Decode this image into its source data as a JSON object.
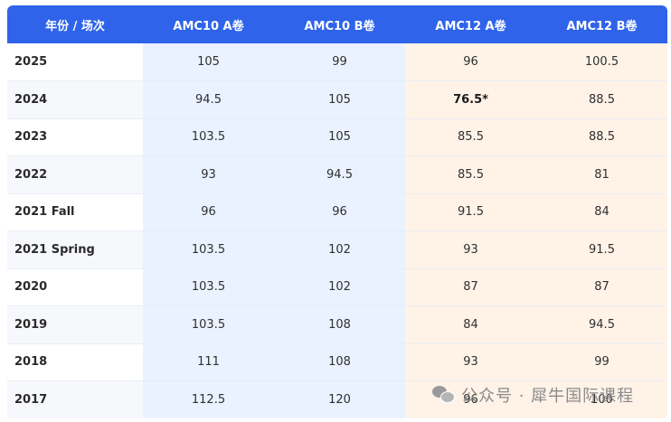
{
  "table": {
    "headers": [
      "年份 / 场次",
      "AMC10 A卷",
      "AMC10 B卷",
      "AMC12 A卷",
      "AMC12 B卷"
    ],
    "rows": [
      {
        "year": "2025",
        "amc10a": "105",
        "amc10b": "99",
        "amc12a": "96",
        "amc12b": "100.5"
      },
      {
        "year": "2024",
        "amc10a": "94.5",
        "amc10b": "105",
        "amc12a": "76.5*",
        "amc12b": "88.5"
      },
      {
        "year": "2023",
        "amc10a": "103.5",
        "amc10b": "105",
        "amc12a": "85.5",
        "amc12b": "88.5"
      },
      {
        "year": "2022",
        "amc10a": "93",
        "amc10b": "94.5",
        "amc12a": "85.5",
        "amc12b": "81"
      },
      {
        "year": "2021 Fall",
        "amc10a": "96",
        "amc10b": "96",
        "amc12a": "91.5",
        "amc12b": "84"
      },
      {
        "year": "2021 Spring",
        "amc10a": "103.5",
        "amc10b": "102",
        "amc12a": "93",
        "amc12b": "91.5"
      },
      {
        "year": "2020",
        "amc10a": "103.5",
        "amc10b": "102",
        "amc12a": "87",
        "amc12b": "87"
      },
      {
        "year": "2019",
        "amc10a": "103.5",
        "amc10b": "108",
        "amc12a": "84",
        "amc12b": "94.5"
      },
      {
        "year": "2018",
        "amc10a": "111",
        "amc10b": "108",
        "amc12a": "93",
        "amc12b": "99"
      },
      {
        "year": "2017",
        "amc10a": "112.5",
        "amc10b": "120",
        "amc12a": "96",
        "amc12b": "100"
      }
    ]
  },
  "watermark": {
    "text": "公众号 · 犀牛国际课程",
    "icon": "wechat-icon"
  },
  "colors": {
    "header_bg": "#2e63ea",
    "amc10_col_bg": "#eaf2ff",
    "amc12_col_bg": "#fff3e8"
  }
}
